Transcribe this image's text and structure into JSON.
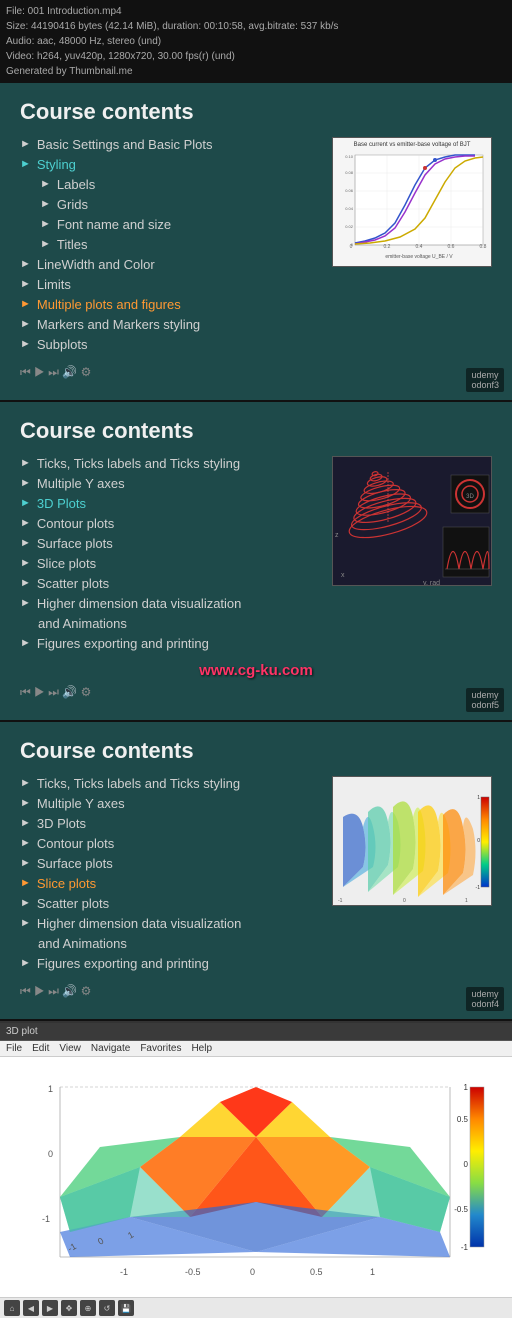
{
  "infoBar": {
    "line1": "File: 001 Introduction.mp4",
    "line2": "Size: 44190416 bytes (42.14 MiB), duration: 00:10:58, avg.bitrate: 537 kb/s",
    "line3": "Audio: aac, 48000 Hz, stereo (und)",
    "line4": "Video: h264, yuv420p, 1280x720, 30.00 fps(r) (und)",
    "line5": "Generated by Thumbnail.me"
  },
  "sections": [
    {
      "title": "Course contents",
      "items": [
        {
          "text": "Basic Settings and Basic Plots",
          "style": "normal",
          "indent": 0
        },
        {
          "text": "Styling",
          "style": "active",
          "indent": 0
        },
        {
          "text": "Labels",
          "style": "normal",
          "indent": 1
        },
        {
          "text": "Grids",
          "style": "normal",
          "indent": 1
        },
        {
          "text": "Font name and size",
          "style": "normal",
          "indent": 1
        },
        {
          "text": "Titles",
          "style": "normal",
          "indent": 1
        },
        {
          "text": "LineWidth and Color",
          "style": "normal",
          "indent": 0
        },
        {
          "text": "Limits",
          "style": "normal",
          "indent": 0
        },
        {
          "text": "Multiple plots and figures",
          "style": "highlighted",
          "indent": 0
        },
        {
          "text": "Markers and Markers styling",
          "style": "normal",
          "indent": 0
        },
        {
          "text": "Subplots",
          "style": "normal",
          "indent": 0
        }
      ],
      "chartType": "bjt",
      "chartTitle": "Base current vs emitter-base voltage of BJT"
    },
    {
      "title": "Course contents",
      "items": [
        {
          "text": "Ticks, Ticks labels and Ticks styling",
          "style": "normal",
          "indent": 0
        },
        {
          "text": "Multiple Y axes",
          "style": "normal",
          "indent": 0
        },
        {
          "text": "3D Plots",
          "style": "active",
          "indent": 0
        },
        {
          "text": "Contour plots",
          "style": "normal",
          "indent": 0
        },
        {
          "text": "Surface plots",
          "style": "normal",
          "indent": 0
        },
        {
          "text": "Slice plots",
          "style": "normal",
          "indent": 0
        },
        {
          "text": "Scatter plots",
          "style": "normal",
          "indent": 0
        },
        {
          "text": "Higher dimension data visualization",
          "style": "normal",
          "indent": 0
        },
        {
          "text": "and Animations",
          "style": "normal",
          "indent": 1
        },
        {
          "text": "Figures exporting and printing",
          "style": "normal",
          "indent": 0
        }
      ],
      "chartType": "spiral3d",
      "watermark": "www.cg-ku.com"
    },
    {
      "title": "Course contents",
      "items": [
        {
          "text": "Ticks, Ticks labels and Ticks styling",
          "style": "normal",
          "indent": 0
        },
        {
          "text": "Multiple Y axes",
          "style": "normal",
          "indent": 0
        },
        {
          "text": "3D Plots",
          "style": "normal",
          "indent": 0
        },
        {
          "text": "Contour plots",
          "style": "normal",
          "indent": 0
        },
        {
          "text": "Surface plots",
          "style": "normal",
          "indent": 0
        },
        {
          "text": "Slice plots",
          "style": "highlighted",
          "indent": 0
        },
        {
          "text": "Scatter plots",
          "style": "normal",
          "indent": 0
        },
        {
          "text": "Higher dimension data visualization",
          "style": "normal",
          "indent": 0
        },
        {
          "text": "and Animations",
          "style": "normal",
          "indent": 1
        },
        {
          "text": "Figures exporting and printing",
          "style": "normal",
          "indent": 0
        }
      ],
      "chartType": "surface3d"
    }
  ],
  "plotWindow": {
    "title": "3D plot",
    "menuItems": [
      "File",
      "Edit",
      "View",
      "Navigate",
      "Favorites",
      "Help"
    ]
  },
  "udeyBadges": [
    "odonf3",
    "odonf5",
    "odonf4"
  ],
  "controls": [
    "rewind",
    "play",
    "forward",
    "volume",
    "settings"
  ]
}
